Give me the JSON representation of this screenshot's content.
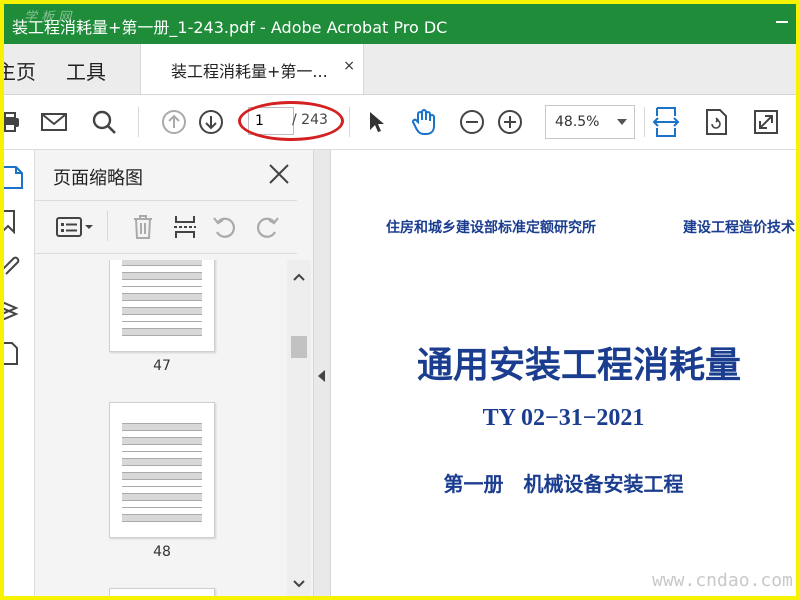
{
  "window": {
    "title": "装工程消耗量+第一册_1-243.pdf - Adobe Acrobat Pro DC",
    "watermark_top": "学 板 网"
  },
  "menu": {
    "home": "主页",
    "tools": "工具"
  },
  "doc_tab": {
    "label": "装工程消耗量+第一...",
    "close": "×"
  },
  "toolbar": {
    "current_page": "1",
    "total_pages": "/ 243",
    "zoom": "48.5%"
  },
  "thumbnail_panel": {
    "title": "页面缩略图",
    "pages": [
      "47",
      "48"
    ]
  },
  "document": {
    "org_left": "住房和城乡建设部标准定额研究所",
    "org_right": "建设工程造价技术",
    "title": "通用安装工程消耗量",
    "code": "TY 02−31−2021",
    "volume": "第一册　机械设备安装工程"
  },
  "watermark_bottom": "www.cndao.com",
  "colors": {
    "title_bar": "#1f8c3a",
    "border": "#f7f200",
    "accent_blue": "#1a73c8",
    "doc_text": "#1b3d8f",
    "annotation_red": "#d42020"
  }
}
